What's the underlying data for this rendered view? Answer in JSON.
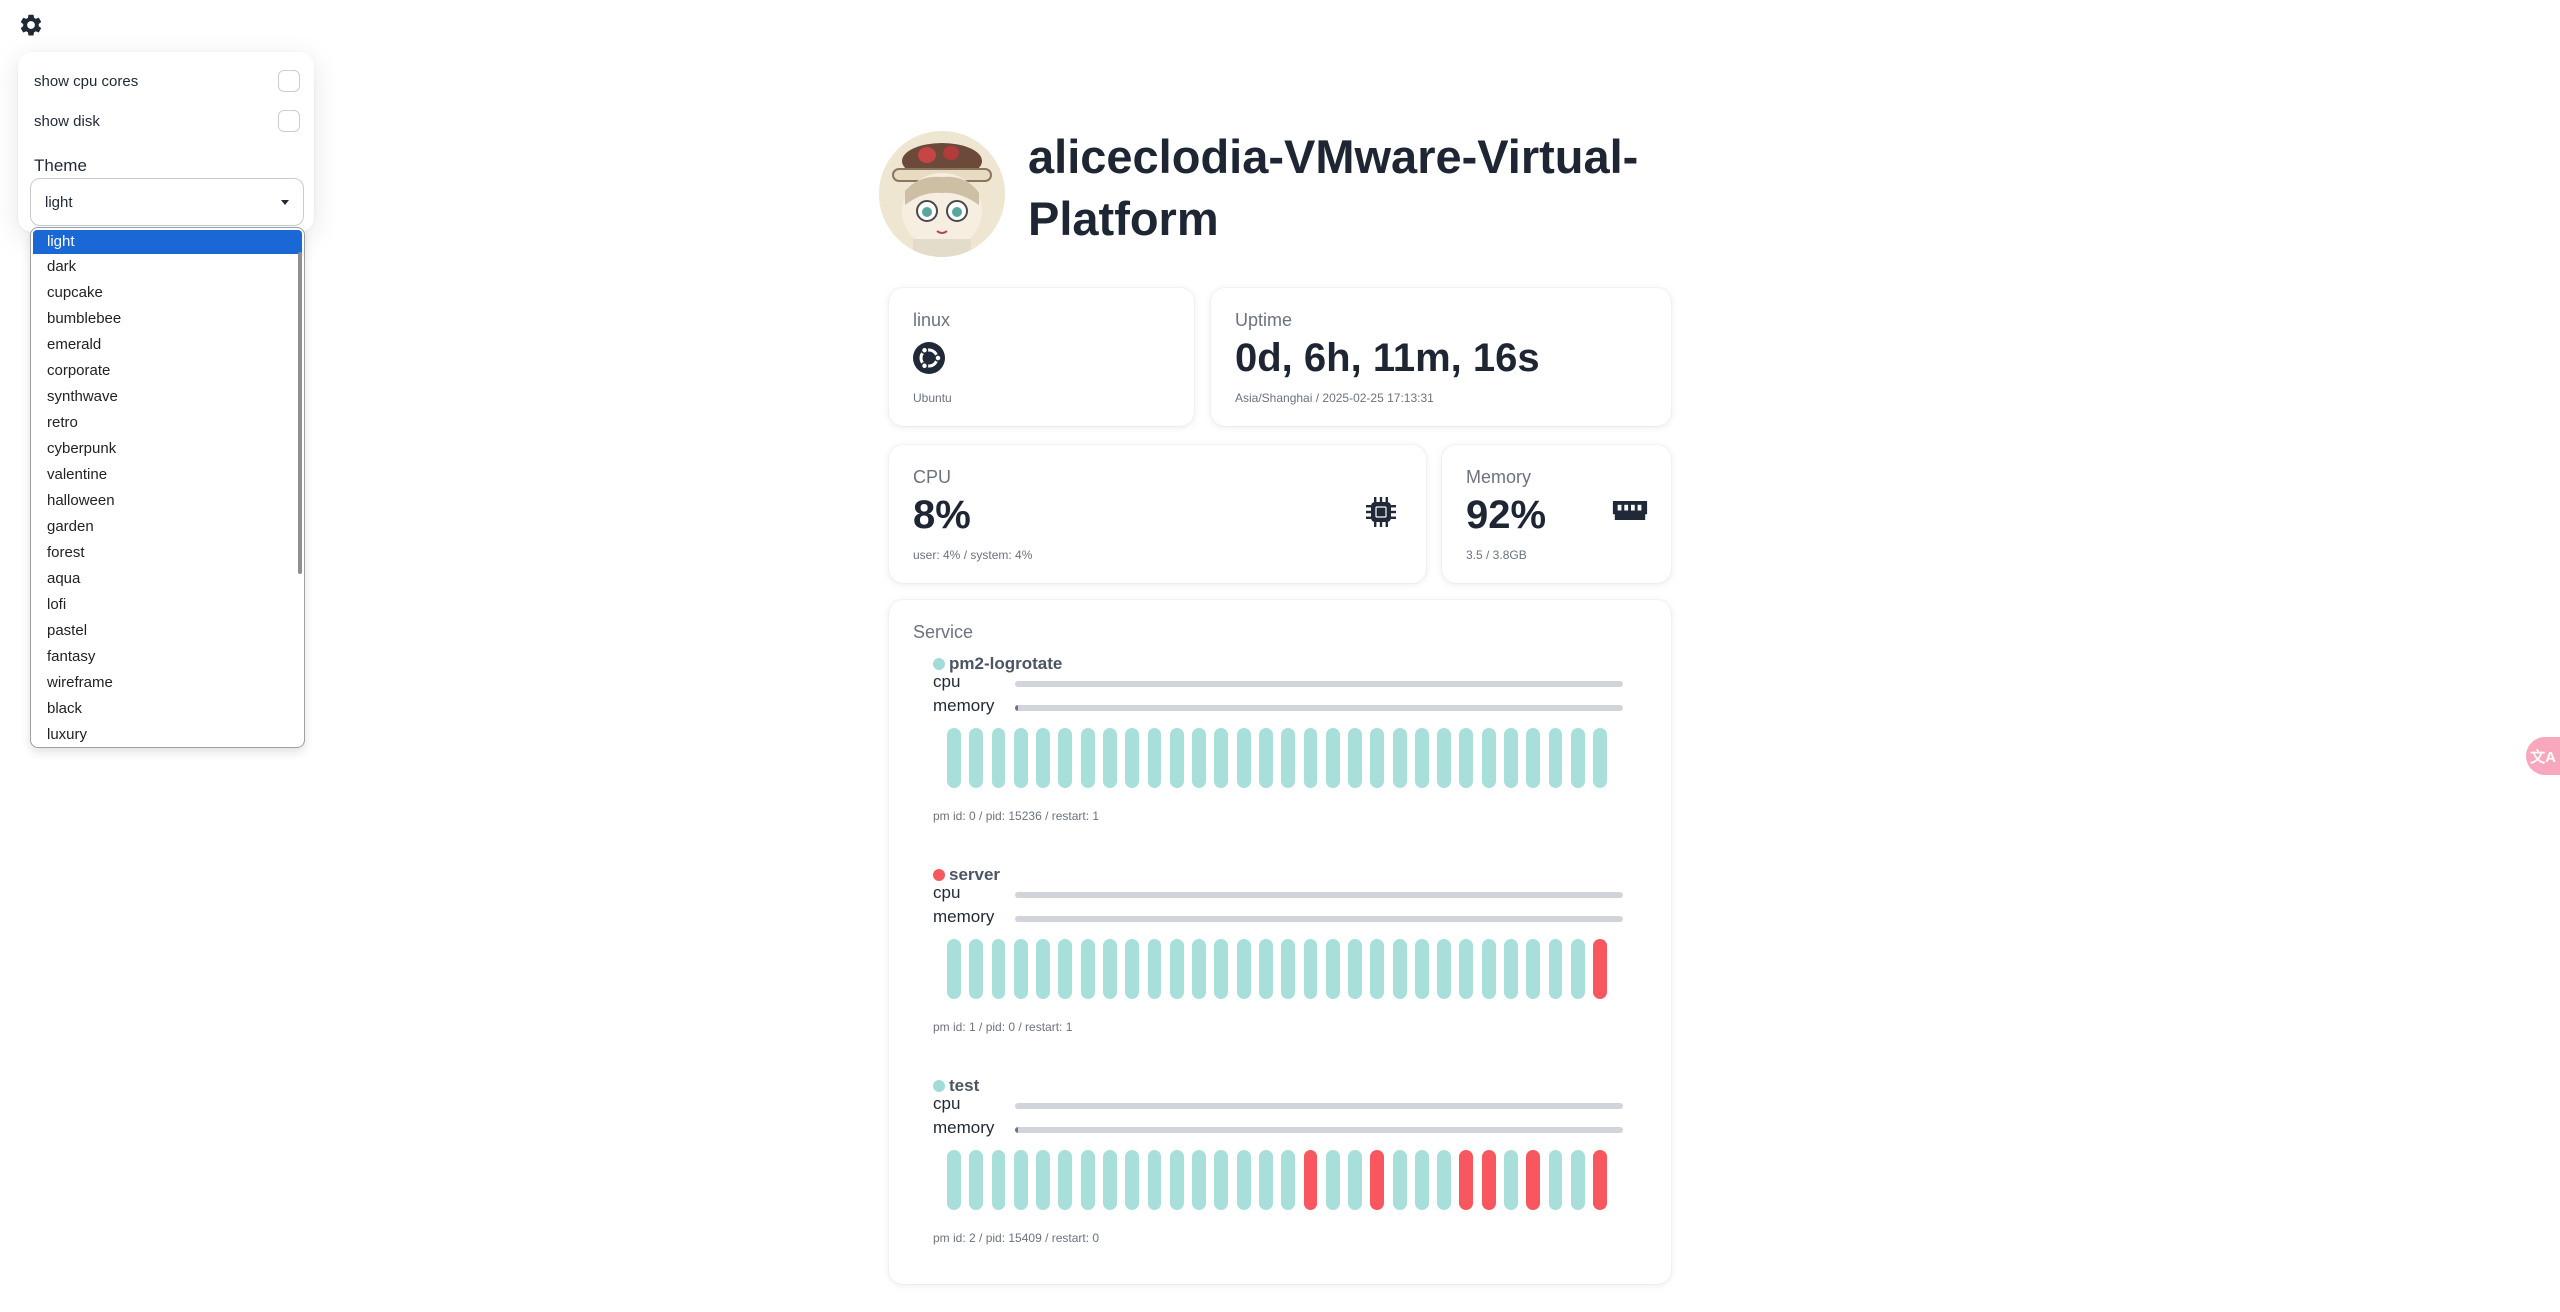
{
  "settings": {
    "show_cpu_cores_label": "show cpu cores",
    "show_disk_label": "show disk",
    "theme_label": "Theme",
    "theme_value": "light",
    "themes": [
      "light",
      "dark",
      "cupcake",
      "bumblebee",
      "emerald",
      "corporate",
      "synthwave",
      "retro",
      "cyberpunk",
      "valentine",
      "halloween",
      "garden",
      "forest",
      "aqua",
      "lofi",
      "pastel",
      "fantasy",
      "wireframe",
      "black",
      "luxury"
    ]
  },
  "host": {
    "title": "aliceclodia-VMware-Virtual-Platform"
  },
  "os": {
    "label": "linux",
    "icon": "ubuntu-icon",
    "name": "Ubuntu"
  },
  "uptime": {
    "label": "Uptime",
    "value": "0d, 6h, 11m, 16s",
    "sub": "Asia/Shanghai / 2025-02-25 17:13:31"
  },
  "cpu": {
    "label": "CPU",
    "value": "8%",
    "sub": "user: 4% / system: 4%",
    "icon": "cpu-chip-icon"
  },
  "memory": {
    "label": "Memory",
    "value": "92%",
    "sub": "3.5 / 3.8GB",
    "icon": "memory-icon"
  },
  "service_section": {
    "title": "Service",
    "metric_cpu_label": "cpu",
    "metric_memory_label": "memory"
  },
  "services": [
    {
      "name": "pm2-logrotate",
      "status_color": "#a3dcd6",
      "cpu_pct": 0,
      "memory_pct": 0.5,
      "footer": "pm id: 0 / pid: 15236 / restart: 1",
      "history": [
        "up",
        "up",
        "up",
        "up",
        "up",
        "up",
        "up",
        "up",
        "up",
        "up",
        "up",
        "up",
        "up",
        "up",
        "up",
        "up",
        "up",
        "up",
        "up",
        "up",
        "up",
        "up",
        "up",
        "up",
        "up",
        "up",
        "up",
        "up",
        "up",
        "up"
      ]
    },
    {
      "name": "server",
      "status_color": "#f8575f",
      "cpu_pct": 0,
      "memory_pct": 0,
      "footer": "pm id: 1 / pid: 0 / restart: 1",
      "history": [
        "up",
        "up",
        "up",
        "up",
        "up",
        "up",
        "up",
        "up",
        "up",
        "up",
        "up",
        "up",
        "up",
        "up",
        "up",
        "up",
        "up",
        "up",
        "up",
        "up",
        "up",
        "up",
        "up",
        "up",
        "up",
        "up",
        "up",
        "up",
        "up",
        "down"
      ]
    },
    {
      "name": "test",
      "status_color": "#a3dcd6",
      "cpu_pct": 0,
      "memory_pct": 0.5,
      "footer": "pm id: 2 / pid: 15409 / restart: 0",
      "history": [
        "up",
        "up",
        "up",
        "up",
        "up",
        "up",
        "up",
        "up",
        "up",
        "up",
        "up",
        "up",
        "up",
        "up",
        "up",
        "up",
        "down",
        "up",
        "up",
        "down",
        "up",
        "up",
        "up",
        "down",
        "down",
        "up",
        "down",
        "up",
        "up",
        "down"
      ]
    }
  ],
  "colors": {
    "up": "#a9dfda",
    "down": "#f8575f",
    "accent": "#1a68d6"
  },
  "translate_button": "文A"
}
